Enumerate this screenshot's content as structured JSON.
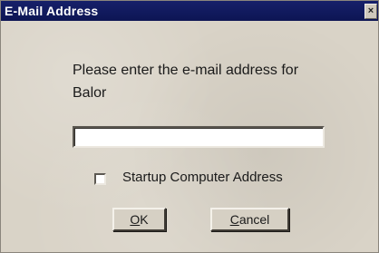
{
  "window": {
    "title": "E-Mail Address",
    "close_glyph": "×"
  },
  "prompt": {
    "line1": "Please enter the e-mail address for",
    "line2": "Balor"
  },
  "email_input": {
    "value": "",
    "placeholder": ""
  },
  "startup_checkbox": {
    "label": "Startup Computer Address",
    "checked": false
  },
  "buttons": {
    "ok": {
      "mnemonic": "O",
      "rest": "K"
    },
    "cancel": {
      "mnemonic": "C",
      "rest": "ancel"
    }
  },
  "colors": {
    "titlebar": "#16206a",
    "dialog_bg": "#d9d3c7"
  },
  "icons": {
    "close": "close-icon"
  }
}
